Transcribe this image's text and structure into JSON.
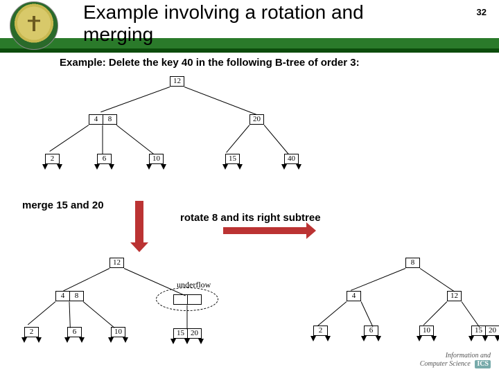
{
  "header": {
    "title": "Example involving a rotation and merging",
    "page_number": "32"
  },
  "subtitle": "Example: Delete the key 40 in the following B-tree of order 3:",
  "labels": {
    "merge": "merge 15 and 20",
    "rotate": "rotate 8 and its right subtree",
    "underflow": "underflow"
  },
  "top_tree": {
    "root": [
      "12"
    ],
    "l1": [
      [
        "4",
        "8"
      ],
      [
        "20"
      ]
    ],
    "l2": [
      [
        "2"
      ],
      [
        "6"
      ],
      [
        "10"
      ],
      [
        "15"
      ],
      [
        "40"
      ]
    ]
  },
  "mid_tree": {
    "root": [
      "12"
    ],
    "l1": [
      [
        "4",
        "8"
      ],
      [
        "",
        ""
      ]
    ],
    "l2": [
      [
        "2"
      ],
      [
        "6"
      ],
      [
        "10"
      ],
      [
        "15",
        "20"
      ]
    ]
  },
  "right_tree": {
    "root": [
      "8"
    ],
    "l1": [
      [
        "4"
      ],
      [
        "12"
      ]
    ],
    "l2": [
      [
        "2"
      ],
      [
        "6"
      ],
      [
        "10"
      ],
      [
        "15",
        "20"
      ]
    ]
  },
  "footer": {
    "line1": "Information and",
    "line2": "Computer Science",
    "badge": "ICS"
  }
}
